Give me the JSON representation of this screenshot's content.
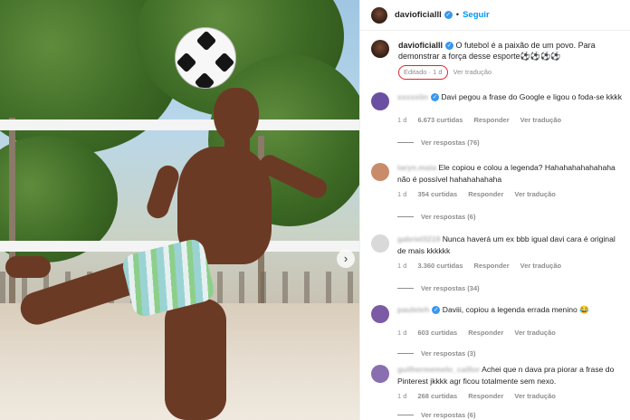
{
  "post": {
    "username": "davioficialll",
    "follow_label": "Seguir",
    "separator": "•",
    "caption": "O futebol é a paixão de um povo. Para demonstrar a força desse esporte⚽⚽⚽⚽",
    "edited_label": "Editado · 1 d",
    "translate_label": "Ver tradução"
  },
  "comments": [
    {
      "username": "xxxxxiin",
      "verified": true,
      "text": "Davi pegou a frase do Google e ligou o foda-se kkkk",
      "time": "1 d",
      "likes": "6.673 curtidas",
      "reply_label": "Responder",
      "translate_label": "Ver tradução",
      "replies_label": "Ver respostas (76)",
      "avatar_color": "#6a4fa3"
    },
    {
      "username": "taryn.maia",
      "verified": false,
      "text": "Ele copiou e colou a legenda? Hahahahahahahaha não é possível hahahahahaha",
      "time": "1 d",
      "likes": "354 curtidas",
      "reply_label": "Responder",
      "translate_label": "Ver tradução",
      "replies_label": "Ver respostas (6)",
      "avatar_color": "#c98c6a"
    },
    {
      "username": "gabriel3219",
      "verified": false,
      "text": "Nunca haverá um ex bbb igual davi cara é original de mais kkkkkk",
      "time": "1 d",
      "likes": "3.360 curtidas",
      "reply_label": "Responder",
      "translate_label": "Ver tradução",
      "replies_label": "Ver respostas (34)",
      "avatar_color": "#d9d9d9"
    },
    {
      "username": "pauleteh",
      "verified": true,
      "text": "Daviii, copiou a legenda errada menino 😂",
      "time": "1 d",
      "likes": "603 curtidas",
      "reply_label": "Responder",
      "translate_label": "Ver tradução",
      "replies_label": "Ver respostas (3)",
      "avatar_color": "#7b5aa6"
    },
    {
      "username": "guilhermemelo_caillor",
      "verified": false,
      "text": "Achei que n dava pra piorar a frase do Pinterest jkkkk agr ficou totalmente sem nexo.",
      "time": "1 d",
      "likes": "268 curtidas",
      "reply_label": "Responder",
      "translate_label": "Ver tradução",
      "replies_label": "Ver respostas (6)",
      "avatar_color": "#8a6fb0"
    }
  ],
  "colors": {
    "follow": "#0095f6",
    "verified": "#3897f0",
    "edited_highlight": "#e0242b",
    "muted": "#8e8e8e"
  }
}
